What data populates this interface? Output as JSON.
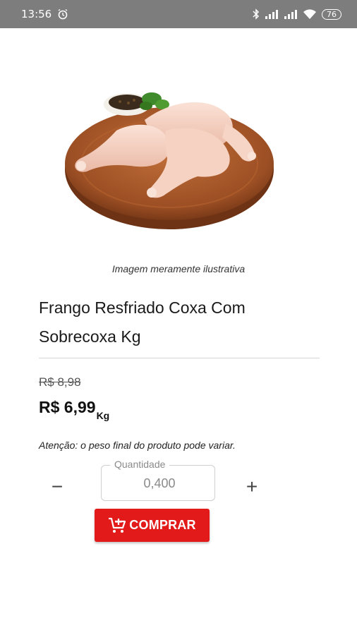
{
  "status_bar": {
    "time": "13:56",
    "battery": "76",
    "icons": [
      "alarm-icon",
      "bluetooth-icon",
      "signal-icon",
      "signal-icon",
      "wifi-icon",
      "battery-icon"
    ]
  },
  "product": {
    "image_icon": "chicken-thigh-photo",
    "image_note": "Imagem meramente ilustrativa",
    "name": "Frango Resfriado Coxa Com Sobrecoxa Kg",
    "old_price": "R$ 8,98",
    "price": "R$ 6,99",
    "unit": "Kg",
    "weight_warning": "Atenção: o peso final do produto pode variar."
  },
  "quantity": {
    "label": "Quantidade",
    "value": "0,400",
    "decrement": "−",
    "increment": "+"
  },
  "buy_button": {
    "label": "COMPRAR",
    "icon": "add-to-cart-icon"
  },
  "colors": {
    "status_bar": "#7d7d7d",
    "accent": "#e21a1a"
  }
}
